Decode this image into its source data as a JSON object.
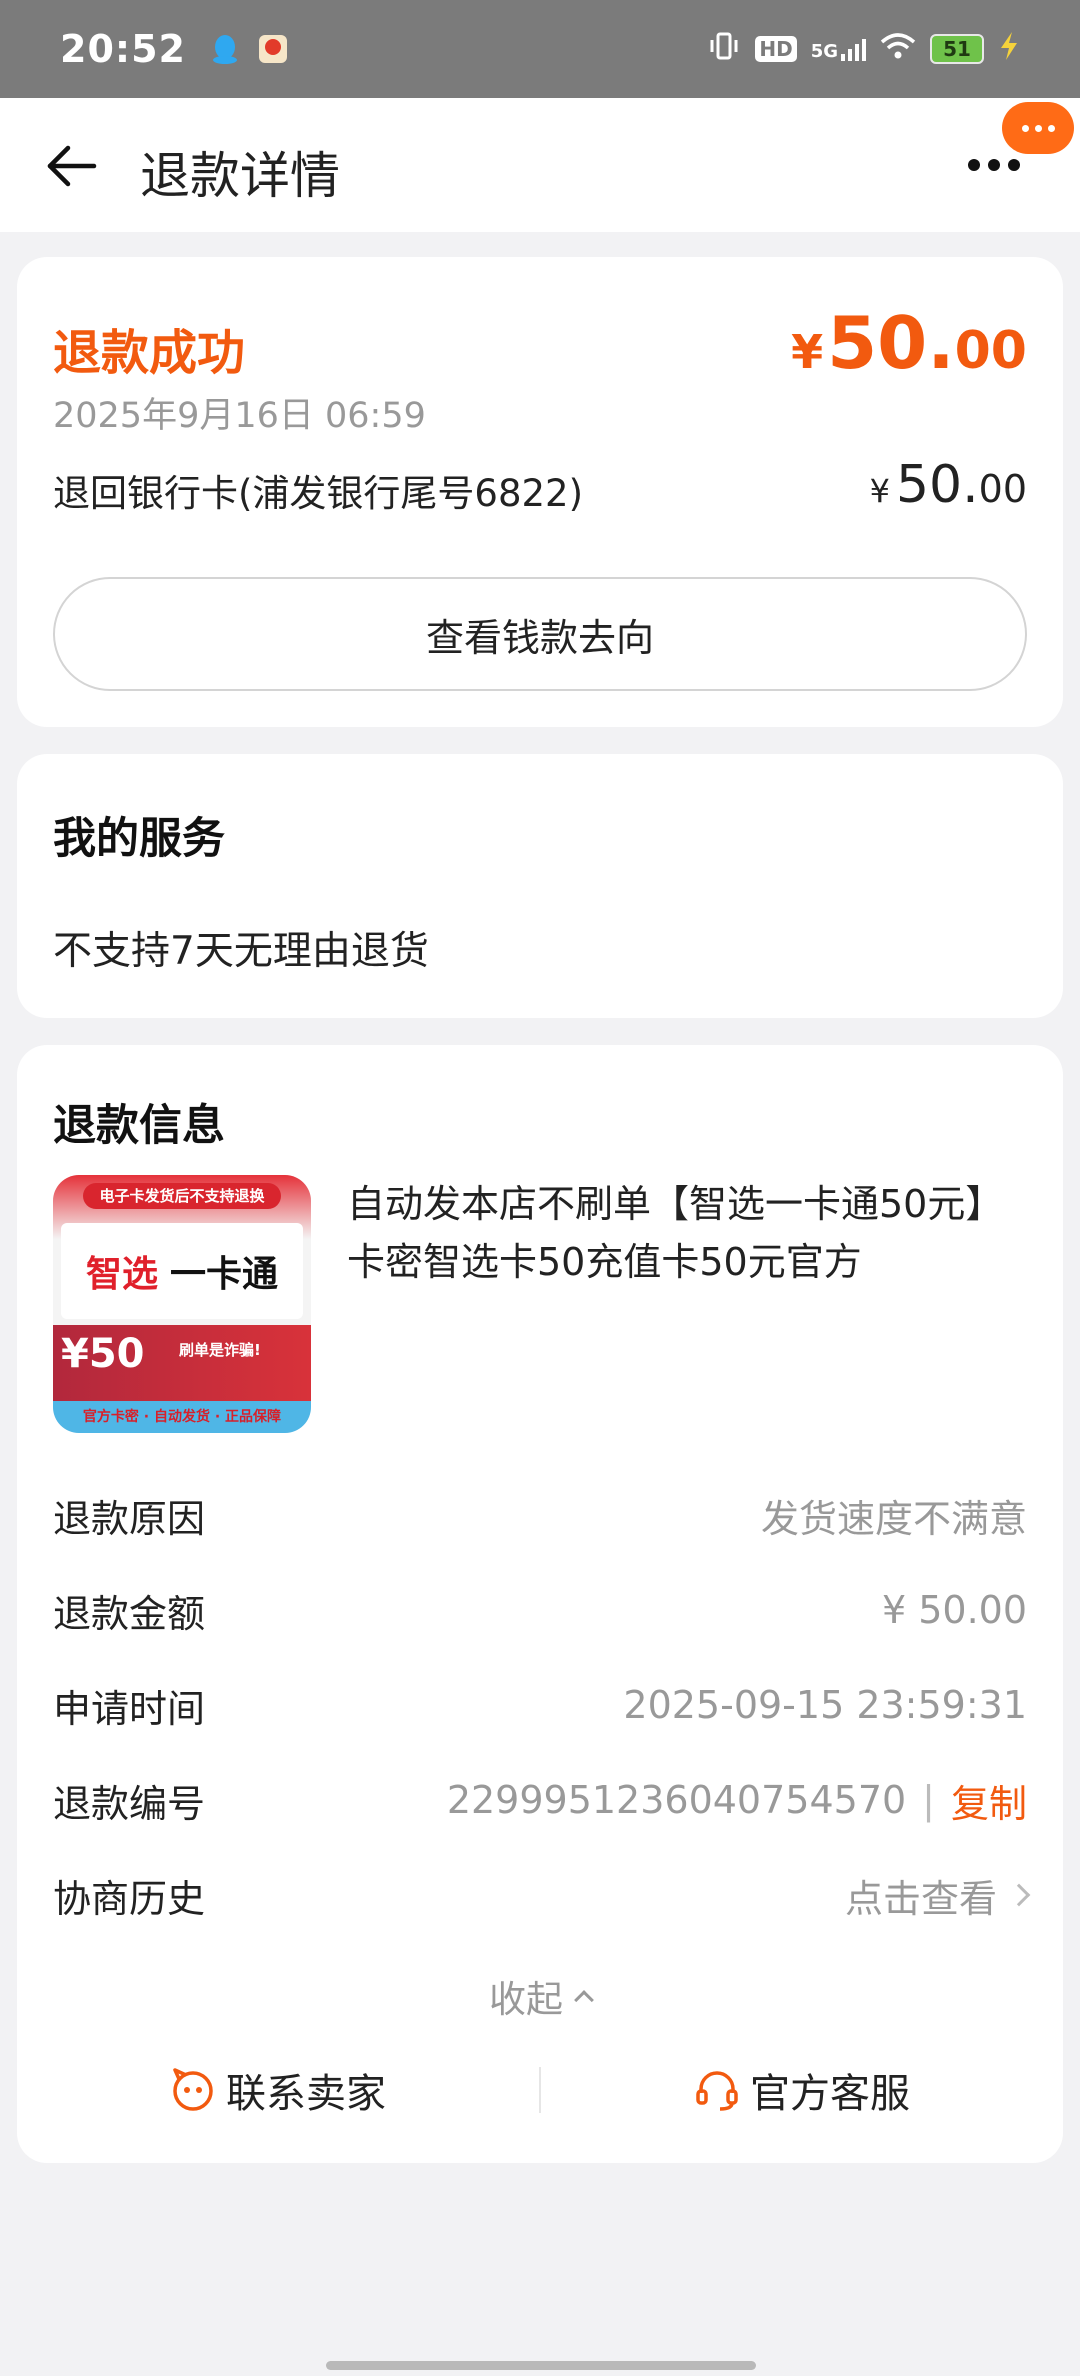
{
  "status_bar": {
    "time": "20:52",
    "network": "5G",
    "hd_label": "HD",
    "battery": "51"
  },
  "nav": {
    "title": "退款详情"
  },
  "refund_status": {
    "title": "退款成功",
    "amount_currency": "¥",
    "amount_int": "50.",
    "amount_dec": "00",
    "time": "2025年9月16日 06:59",
    "destination": "退回银行卡(浦发银行尾号6822)",
    "destination_currency": "¥",
    "destination_int": "50.",
    "destination_dec": "00",
    "track_button": "查看钱款去向"
  },
  "service": {
    "title": "我的服务",
    "text": "不支持7天无理由退货"
  },
  "refund_info": {
    "title": "退款信息",
    "product": {
      "title": "自动发本店不刷单【智选一卡通50元】卡密智选卡50充值卡50元官方",
      "thumb_banner": "电子卡发货后不支持退换",
      "thumb_brand1": "智选",
      "thumb_brand2": "一卡通",
      "thumb_price": "¥50",
      "thumb_warning": "刷单是诈骗!",
      "thumb_footer": "官方卡密 · 自动发货 · 正品保障"
    },
    "rows": [
      {
        "label": "退款原因",
        "value": "发货速度不满意"
      },
      {
        "label": "退款金额",
        "value": "¥ 50.00"
      },
      {
        "label": "申请时间",
        "value": "2025-09-15 23:59:31"
      },
      {
        "label": "退款编号",
        "value": "2299951236040754570",
        "action": "复制"
      },
      {
        "label": "协商历史",
        "value": "点击查看"
      }
    ],
    "collapse": "收起",
    "contact_seller": "联系卖家",
    "official_service": "官方客服"
  },
  "colors": {
    "accent": "#f25a0f",
    "background": "#f2f2f4",
    "status_bar": "#7b7b7b"
  }
}
